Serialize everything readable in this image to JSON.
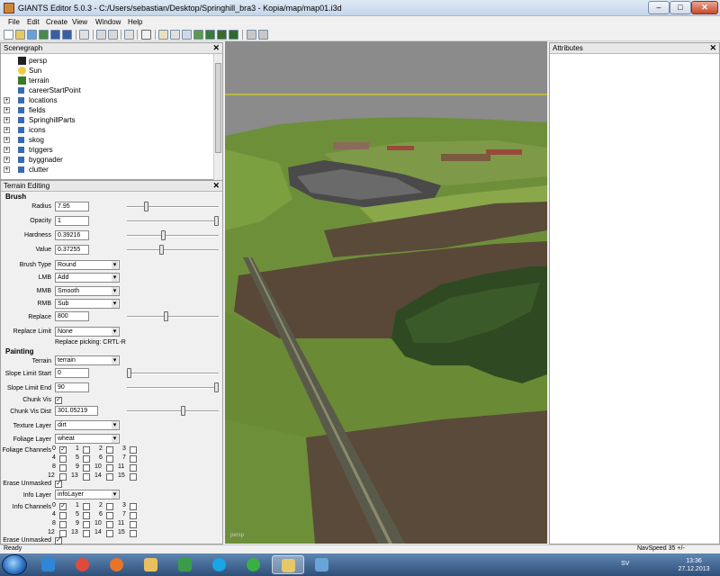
{
  "window": {
    "title": "GIANTS Editor 5.0.3 - C:/Users/sebastian/Desktop/Springhill_bra3 - Kopia/map/map01.i3d",
    "minimize": "–",
    "maximize": "□",
    "close": "✕"
  },
  "menu": [
    "File",
    "Edit",
    "Create",
    "View",
    "Window",
    "Help"
  ],
  "scenegraph": {
    "title": "Scenegraph",
    "close": "✕",
    "items": [
      {
        "label": "persp",
        "icon": "camera-icon",
        "expandable": false
      },
      {
        "label": "Sun",
        "icon": "light-icon",
        "expandable": false
      },
      {
        "label": "terrain",
        "icon": "terrain-icon",
        "expandable": false
      },
      {
        "label": "careerStartPoint",
        "icon": "transform-group-icon",
        "expandable": false
      },
      {
        "label": "locations",
        "icon": "transform-group-icon",
        "expandable": true
      },
      {
        "label": "fields",
        "icon": "transform-group-icon",
        "expandable": true
      },
      {
        "label": "SpringhillParts",
        "icon": "transform-group-icon",
        "expandable": true
      },
      {
        "label": "icons",
        "icon": "transform-group-icon",
        "expandable": true
      },
      {
        "label": "skog",
        "icon": "transform-group-icon",
        "expandable": true
      },
      {
        "label": "triggers",
        "icon": "transform-group-icon",
        "expandable": true
      },
      {
        "label": "byggnader",
        "icon": "transform-group-icon",
        "expandable": true
      },
      {
        "label": "clutter",
        "icon": "transform-group-icon",
        "expandable": true
      }
    ]
  },
  "terrain_editing": {
    "title": "Terrain Editing",
    "close": "✕",
    "brush_section": "Brush",
    "radius": {
      "label": "Radius",
      "value": "7.95",
      "slider": 0.2
    },
    "opacity": {
      "label": "Opacity",
      "value": "1",
      "slider": 1.0
    },
    "hardness": {
      "label": "Hardness",
      "value": "0.39216",
      "slider": 0.39216
    },
    "value": {
      "label": "Value",
      "value": "0.37255",
      "slider": 0.37255
    },
    "brush_type": {
      "label": "Brush Type",
      "value": "Round"
    },
    "lmb": {
      "label": "LMB",
      "value": "Add"
    },
    "mmb": {
      "label": "MMB",
      "value": "Smooth"
    },
    "rmb": {
      "label": "RMB",
      "value": "Sub"
    },
    "replace": {
      "label": "Replace",
      "value": "800",
      "slider": 0.42
    },
    "replace_limit": {
      "label": "Replace Limit",
      "value": "None"
    },
    "replace_picking": "Replace picking: CRTL-R",
    "painting_section": "Painting",
    "terrain": {
      "label": "Terrain",
      "value": "terrain"
    },
    "slope_start": {
      "label": "Slope Limit Start",
      "value": "0",
      "slider": 0.0
    },
    "slope_end": {
      "label": "Slope Limit End",
      "value": "90",
      "slider": 1.0
    },
    "chunk_vis": {
      "label": "Chunk Vis",
      "checked": true
    },
    "chunk_vis_dist": {
      "label": "Chunk Vis Dist",
      "value": "301.05219",
      "slider": 0.62
    },
    "texture_layer": {
      "label": "Texture Layer",
      "value": "dirt"
    },
    "foliage_layer": {
      "label": "Foliage Layer",
      "value": "wheat"
    },
    "foliage_channels": {
      "label": "Foliage Channels",
      "checked": [
        0
      ]
    },
    "erase_unmasked_1": {
      "label": "Erase Unmasked",
      "checked": true
    },
    "info_layer": {
      "label": "Info Layer",
      "value": "infoLayer"
    },
    "info_channels": {
      "label": "Info Channels",
      "checked": [
        0
      ]
    },
    "erase_unmasked_2": {
      "label": "Erase Unmasked",
      "checked": true
    },
    "channel_numbers": [
      "0",
      "1",
      "2",
      "3",
      "4",
      "5",
      "6",
      "7",
      "8",
      "9",
      "10",
      "11",
      "12",
      "13",
      "14",
      "15"
    ]
  },
  "viewport": {
    "camera_label": "persp"
  },
  "attributes": {
    "title": "Attributes",
    "close": "✕"
  },
  "statusbar": {
    "ready": "Ready",
    "navspeed": "NavSpeed 35 +/-"
  },
  "taskbar": {
    "apps": [
      {
        "name": "internet-explorer-icon",
        "color": "#2f86d6"
      },
      {
        "name": "chrome-icon",
        "color": "#e04a3a"
      },
      {
        "name": "firefox-icon",
        "color": "#e8742a"
      },
      {
        "name": "explorer-folder-icon",
        "color": "#e8c060"
      },
      {
        "name": "media-player-icon",
        "color": "#3a9c4a"
      },
      {
        "name": "skype-icon",
        "color": "#19a6e6"
      },
      {
        "name": "spotify-icon",
        "color": "#3aaf44"
      },
      {
        "name": "giants-editor-icon",
        "color": "#e6c86a"
      },
      {
        "name": "paint-icon",
        "color": "#68a4d8"
      }
    ],
    "language": "SV",
    "time": "13:36",
    "date": "27.12.2013"
  },
  "colors": {
    "sky": "#8b8b8b",
    "grass": "#6e8f3a",
    "field_brown": "#5a4a3a",
    "forest": "#2f4a22",
    "horizon_line": "#e8e000"
  }
}
